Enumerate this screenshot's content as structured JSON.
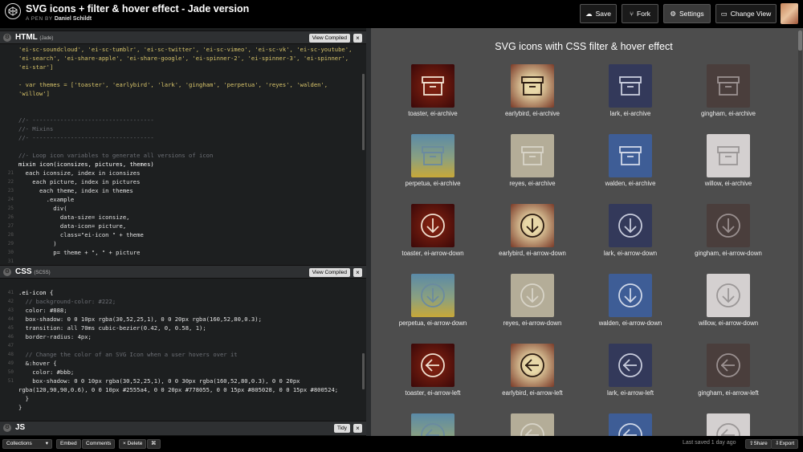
{
  "topbar": {
    "title": "SVG icons + filter & hover effect - Jade version",
    "byline_prefix": "A PEN BY",
    "author": "Daniel Schildt",
    "save": "Save",
    "fork": "Fork",
    "settings": "Settings",
    "change_view": "Change View"
  },
  "html_panel": {
    "name": "HTML",
    "sub": "(Jade)",
    "view_compiled": "View Compiled",
    "close": "×",
    "lines": [
      {
        "n": "",
        "t": "'ei-sc-soundcloud', 'ei-sc-tumblr', 'ei-sc-twitter', 'ei-sc-vimeo', 'ei-sc-vk', 'ei-sc-youtube',",
        "c": "c-str"
      },
      {
        "n": "",
        "t": "'ei-search', 'ei-share-apple', 'ei-share-google', 'ei-spinner-2', 'ei-spinner-3', 'ei-spinner',",
        "c": "c-str"
      },
      {
        "n": "",
        "t": "'ei-star']",
        "c": "c-str"
      },
      {
        "n": "",
        "t": "",
        "c": ""
      },
      {
        "n": "",
        "t": "- var themes = ['toaster', 'earlybird', 'lark', 'gingham', 'perpetua', 'reyes', 'walden',",
        "c": "c-str"
      },
      {
        "n": "",
        "t": "'willow']",
        "c": "c-str"
      },
      {
        "n": "",
        "t": "",
        "c": ""
      },
      {
        "n": "",
        "t": "",
        "c": ""
      },
      {
        "n": "",
        "t": "//- -----------------------------------",
        "c": "c-com"
      },
      {
        "n": "",
        "t": "//- Mixins",
        "c": "c-com"
      },
      {
        "n": "",
        "t": "//- -----------------------------------",
        "c": "c-com"
      },
      {
        "n": "",
        "t": "",
        "c": ""
      },
      {
        "n": "",
        "t": "//- Loop icon variables to generate all versions of icon",
        "c": "c-com"
      },
      {
        "n": "",
        "t": "mixin icon(iconsizes, pictures, themes)",
        "c": "c-fn"
      },
      {
        "n": "21",
        "t": "  each iconsize, index in iconsizes",
        "c": "c-kw"
      },
      {
        "n": "22",
        "t": "    each picture, index in pictures",
        "c": "c-kw"
      },
      {
        "n": "23",
        "t": "      each theme, index in themes",
        "c": "c-kw"
      },
      {
        "n": "24",
        "t": "        .example",
        "c": "c-kw"
      },
      {
        "n": "25",
        "t": "          div(",
        "c": "c-kw"
      },
      {
        "n": "26",
        "t": "            data-size= iconsize,",
        "c": "c-kw"
      },
      {
        "n": "27",
        "t": "            data-icon= picture,",
        "c": "c-kw"
      },
      {
        "n": "28",
        "t": "            class=\"ei-icon \" + theme",
        "c": "c-kw"
      },
      {
        "n": "29",
        "t": "          )",
        "c": "c-kw"
      },
      {
        "n": "30",
        "t": "          p= theme + \", \" + picture",
        "c": "c-kw"
      },
      {
        "n": "31",
        "t": "",
        "c": ""
      }
    ]
  },
  "css_panel": {
    "name": "CSS",
    "sub": "(SCSS)",
    "view_compiled": "View Compiled",
    "close": "×",
    "lines": [
      {
        "n": "",
        "t": "",
        "c": ""
      },
      {
        "n": "41",
        "t": ".ei-icon {",
        "c": "c-fn"
      },
      {
        "n": "42",
        "t": "  // background-color: #222;",
        "c": "c-com"
      },
      {
        "n": "43",
        "t": "  color: #888;",
        "c": "c-kw"
      },
      {
        "n": "44",
        "t": "  box-shadow: 0 0 10px rgba(30,52,25,1), 0 0 20px rgba(160,52,80,0.3);",
        "c": "c-kw"
      },
      {
        "n": "45",
        "t": "  transition: all 70ms cubic-bezier(0.42, 0, 0.58, 1);",
        "c": "c-kw"
      },
      {
        "n": "46",
        "t": "  border-radius: 4px;",
        "c": "c-kw"
      },
      {
        "n": "47",
        "t": "",
        "c": ""
      },
      {
        "n": "48",
        "t": "  // Change the color of an SVG Icon when a user hovers over it",
        "c": "c-com"
      },
      {
        "n": "49",
        "t": "  &:hover {",
        "c": "c-kw"
      },
      {
        "n": "50",
        "t": "    color: #bbb;",
        "c": "c-kw"
      },
      {
        "n": "51",
        "t": "    box-shadow: 0 0 10px rgba(30,52,25,1), 0 0 30px rgba(160,52,80,0.3), 0 0 20px",
        "c": "c-kw"
      },
      {
        "n": "",
        "t": "rgba(120,90,90,0.6), 0 0 10px #2555a4, 0 0 20px #778055, 0 0 15px #805028, 0 0 15px #800524;",
        "c": "c-kw"
      },
      {
        "n": "",
        "t": "  }",
        "c": "c-kw"
      },
      {
        "n": "",
        "t": "}",
        "c": "c-kw"
      },
      {
        "n": "",
        "t": "",
        "c": ""
      }
    ]
  },
  "js_panel": {
    "name": "JS",
    "tidy": "Tidy",
    "close": "×"
  },
  "preview": {
    "title": "SVG icons with CSS filter & hover effect",
    "tiles": [
      {
        "label": "toaster, ei-archive",
        "icon": "archive",
        "theme": "toaster"
      },
      {
        "label": "earlybird, ei-archive",
        "icon": "archive",
        "theme": "earlybird"
      },
      {
        "label": "lark, ei-archive",
        "icon": "archive",
        "theme": "lark"
      },
      {
        "label": "gingham, ei-archive",
        "icon": "archive",
        "theme": "gingham"
      },
      {
        "label": "perpetua, ei-archive",
        "icon": "archive",
        "theme": "perpetua"
      },
      {
        "label": "reyes, ei-archive",
        "icon": "archive",
        "theme": "reyes"
      },
      {
        "label": "walden, ei-archive",
        "icon": "archive",
        "theme": "walden"
      },
      {
        "label": "willow, ei-archive",
        "icon": "archive",
        "theme": "willow"
      },
      {
        "label": "toaster, ei-arrow-down",
        "icon": "arrow-down",
        "theme": "toaster"
      },
      {
        "label": "earlybird, ei-arrow-down",
        "icon": "arrow-down",
        "theme": "earlybird"
      },
      {
        "label": "lark, ei-arrow-down",
        "icon": "arrow-down",
        "theme": "lark"
      },
      {
        "label": "gingham, ei-arrow-down",
        "icon": "arrow-down",
        "theme": "gingham"
      },
      {
        "label": "perpetua, ei-arrow-down",
        "icon": "arrow-down",
        "theme": "perpetua"
      },
      {
        "label": "reyes, ei-arrow-down",
        "icon": "arrow-down",
        "theme": "reyes"
      },
      {
        "label": "walden, ei-arrow-down",
        "icon": "arrow-down",
        "theme": "walden"
      },
      {
        "label": "willow, ei-arrow-down",
        "icon": "arrow-down",
        "theme": "willow"
      },
      {
        "label": "toaster, ei-arrow-left",
        "icon": "arrow-left",
        "theme": "toaster"
      },
      {
        "label": "earlybird, ei-arrow-left",
        "icon": "arrow-left",
        "theme": "earlybird"
      },
      {
        "label": "lark, ei-arrow-left",
        "icon": "arrow-left",
        "theme": "lark"
      },
      {
        "label": "gingham, ei-arrow-left",
        "icon": "arrow-left",
        "theme": "gingham"
      },
      {
        "label": "",
        "icon": "arrow-left",
        "theme": "perpetua"
      },
      {
        "label": "",
        "icon": "arrow-left",
        "theme": "reyes"
      },
      {
        "label": "",
        "icon": "arrow-left",
        "theme": "walden"
      },
      {
        "label": "",
        "icon": "arrow-left",
        "theme": "willow"
      }
    ],
    "themes": {
      "toaster": {
        "bg": "radial-gradient(circle,#7a1f10 20%,#3a0808 100%)",
        "stroke": "#f0e0d0"
      },
      "earlybird": {
        "bg": "radial-gradient(circle,#e8d8a8 25%,#7a3a28 100%)",
        "stroke": "#2a1a10"
      },
      "lark": {
        "bg": "#33395a",
        "stroke": "#c8ccdc"
      },
      "gingham": {
        "bg": "#4a3e3c",
        "stroke": "#9a9090"
      },
      "perpetua": {
        "bg": "linear-gradient(180deg,#5a8aa8 0%,#8aa080 55%,#c8a838 100%)",
        "stroke": "#6a8aa0"
      },
      "reyes": {
        "bg": "#b4ad98",
        "stroke": "#d8d4c8"
      },
      "walden": {
        "bg": "#3e5d96",
        "stroke": "#d0d8e8"
      },
      "willow": {
        "bg": "#d4d0d0",
        "stroke": "#9a9696"
      }
    }
  },
  "bottombar": {
    "collections": "Collections",
    "embed": "Embed",
    "comments": "Comments",
    "delete": "× Delete",
    "cmd": "⌘",
    "saved": "Last saved 1 day ago",
    "share": "Share",
    "export": "Export"
  }
}
